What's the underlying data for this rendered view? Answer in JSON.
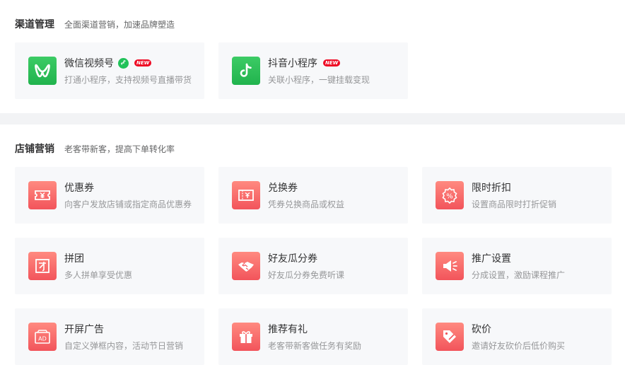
{
  "channel": {
    "title": "渠道管理",
    "subtitle": "全面渠道营销，加速品牌塑造",
    "cards": [
      {
        "title": "微信视频号",
        "desc": "打通小程序，支持视频号直播带货",
        "badge": "NEW",
        "icon": "wechat-channels-icon",
        "color": "#07c160"
      },
      {
        "title": "抖音小程序",
        "desc": "关联小程序，一键挂载变现",
        "badge": "NEW",
        "icon": "douyin-icon",
        "color": "#07c160"
      }
    ]
  },
  "store": {
    "title": "店铺营销",
    "subtitle": "老客带新客，提高下单转化率",
    "cards": [
      {
        "title": "优惠券",
        "desc": "向客户发放店铺或指定商品优惠券",
        "icon": "coupon-icon"
      },
      {
        "title": "兑换券",
        "desc": "凭券兑换商品或权益",
        "icon": "voucher-icon"
      },
      {
        "title": "限时折扣",
        "desc": "设置商品限时打折促销",
        "icon": "discount-icon"
      },
      {
        "title": "拼团",
        "desc": "多人拼单享受优惠",
        "icon": "group-buy-icon"
      },
      {
        "title": "好友瓜分券",
        "desc": "好友瓜分券免费听课",
        "icon": "handshake-icon"
      },
      {
        "title": "推广设置",
        "desc": "分成设置，激励课程推广",
        "icon": "megaphone-icon"
      },
      {
        "title": "开屏广告",
        "desc": "自定义弹框内容，活动节日营销",
        "icon": "ad-icon"
      },
      {
        "title": "推荐有礼",
        "desc": "老客带新客做任务有奖励",
        "icon": "gift-icon"
      },
      {
        "title": "砍价",
        "desc": "邀请好友砍价后低价购买",
        "icon": "bargain-tag-icon"
      }
    ]
  },
  "colors": {
    "accent_green": "#22b34d",
    "accent_red": "#f2545b",
    "badge_red": "#ee0a24"
  }
}
